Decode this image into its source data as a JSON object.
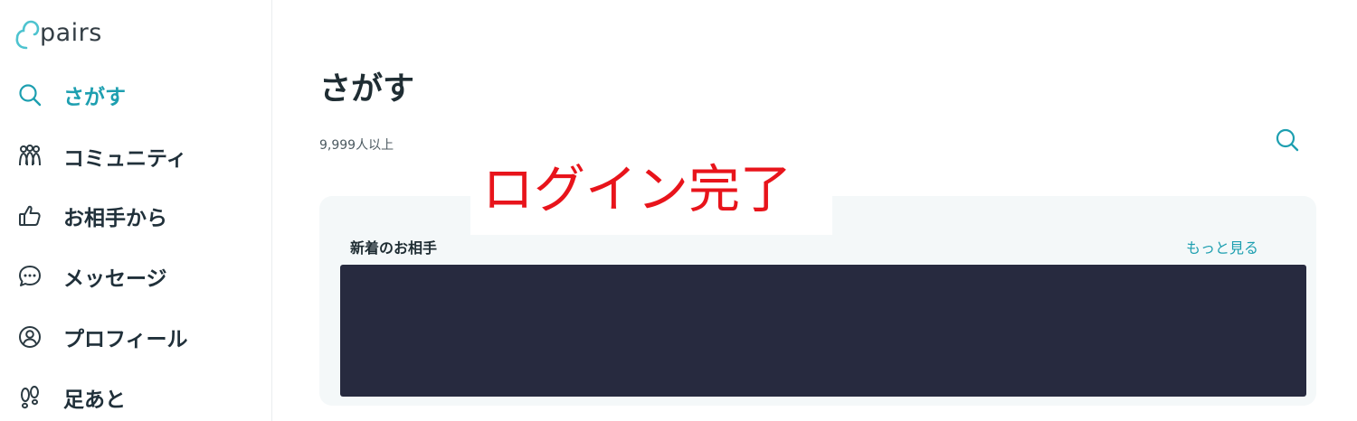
{
  "brand": {
    "logo_text": "pairs",
    "accent": "#1d9fb0",
    "logo_color": "#4dc3cf"
  },
  "sidebar": {
    "items": [
      {
        "label": "さがす",
        "icon": "search-icon",
        "active": true
      },
      {
        "label": "コミュニティ",
        "icon": "community-icon",
        "active": false
      },
      {
        "label": "お相手から",
        "icon": "thumbs-up-icon",
        "active": false
      },
      {
        "label": "メッセージ",
        "icon": "message-icon",
        "active": false
      },
      {
        "label": "プロフィール",
        "icon": "profile-icon",
        "active": false
      },
      {
        "label": "足あと",
        "icon": "footprints-icon",
        "active": false
      }
    ]
  },
  "main": {
    "title": "さがす",
    "count": "9,999人以上",
    "search_icon": "search-icon",
    "section": {
      "title": "新着のお相手",
      "more_label": "もっと見る"
    }
  },
  "overlay": {
    "text": "ログイン完了",
    "color": "#e8141b"
  }
}
